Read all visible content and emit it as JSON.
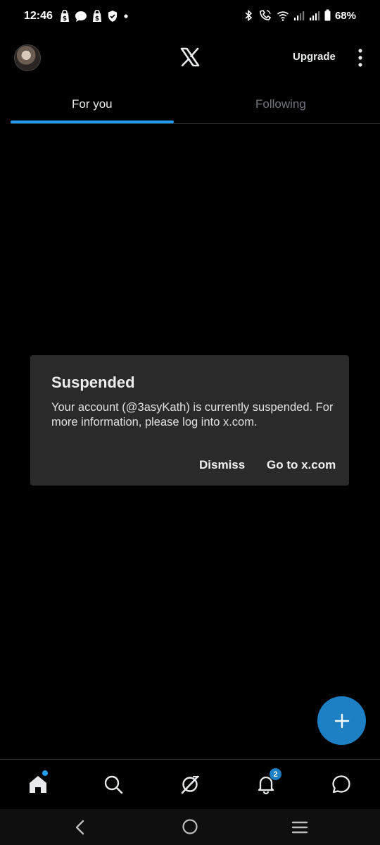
{
  "status_bar": {
    "time": "12:46",
    "battery": "68%",
    "left_icons": [
      "shopping-bag-icon",
      "shopping-bag-icon",
      "chat-bubble-icon",
      "shield-icon",
      "dot-icon"
    ],
    "right_icons": [
      "bluetooth-icon",
      "wifi-calling-icon",
      "wifi-icon",
      "signal-icon",
      "signal-icon",
      "battery-icon"
    ]
  },
  "header": {
    "logo": "x-logo-icon",
    "upgrade_label": "Upgrade",
    "menu_icon": "more-vertical-icon"
  },
  "tabs": [
    {
      "label": "For you",
      "active": true
    },
    {
      "label": "Following",
      "active": false
    }
  ],
  "dialog": {
    "title": "Suspended",
    "body": "Your account (@3asyKath) is currently suspended. For more information, please log into x.com.",
    "dismiss_label": "Dismiss",
    "goto_label": "Go to x.com"
  },
  "fab": {
    "icon": "plus-icon"
  },
  "bottom_nav": {
    "items": [
      "home-icon",
      "search-icon",
      "grok-icon",
      "bell-icon",
      "messages-icon"
    ],
    "notification_count": "2"
  },
  "system_nav": {
    "items": [
      "back-icon",
      "home-circle-icon",
      "recents-icon"
    ]
  },
  "colors": {
    "accent": "#1d9bf0",
    "fab": "#1d7fc4",
    "background": "#000000",
    "dialog": "#2a2a2a",
    "inactive_text": "#71767b"
  }
}
